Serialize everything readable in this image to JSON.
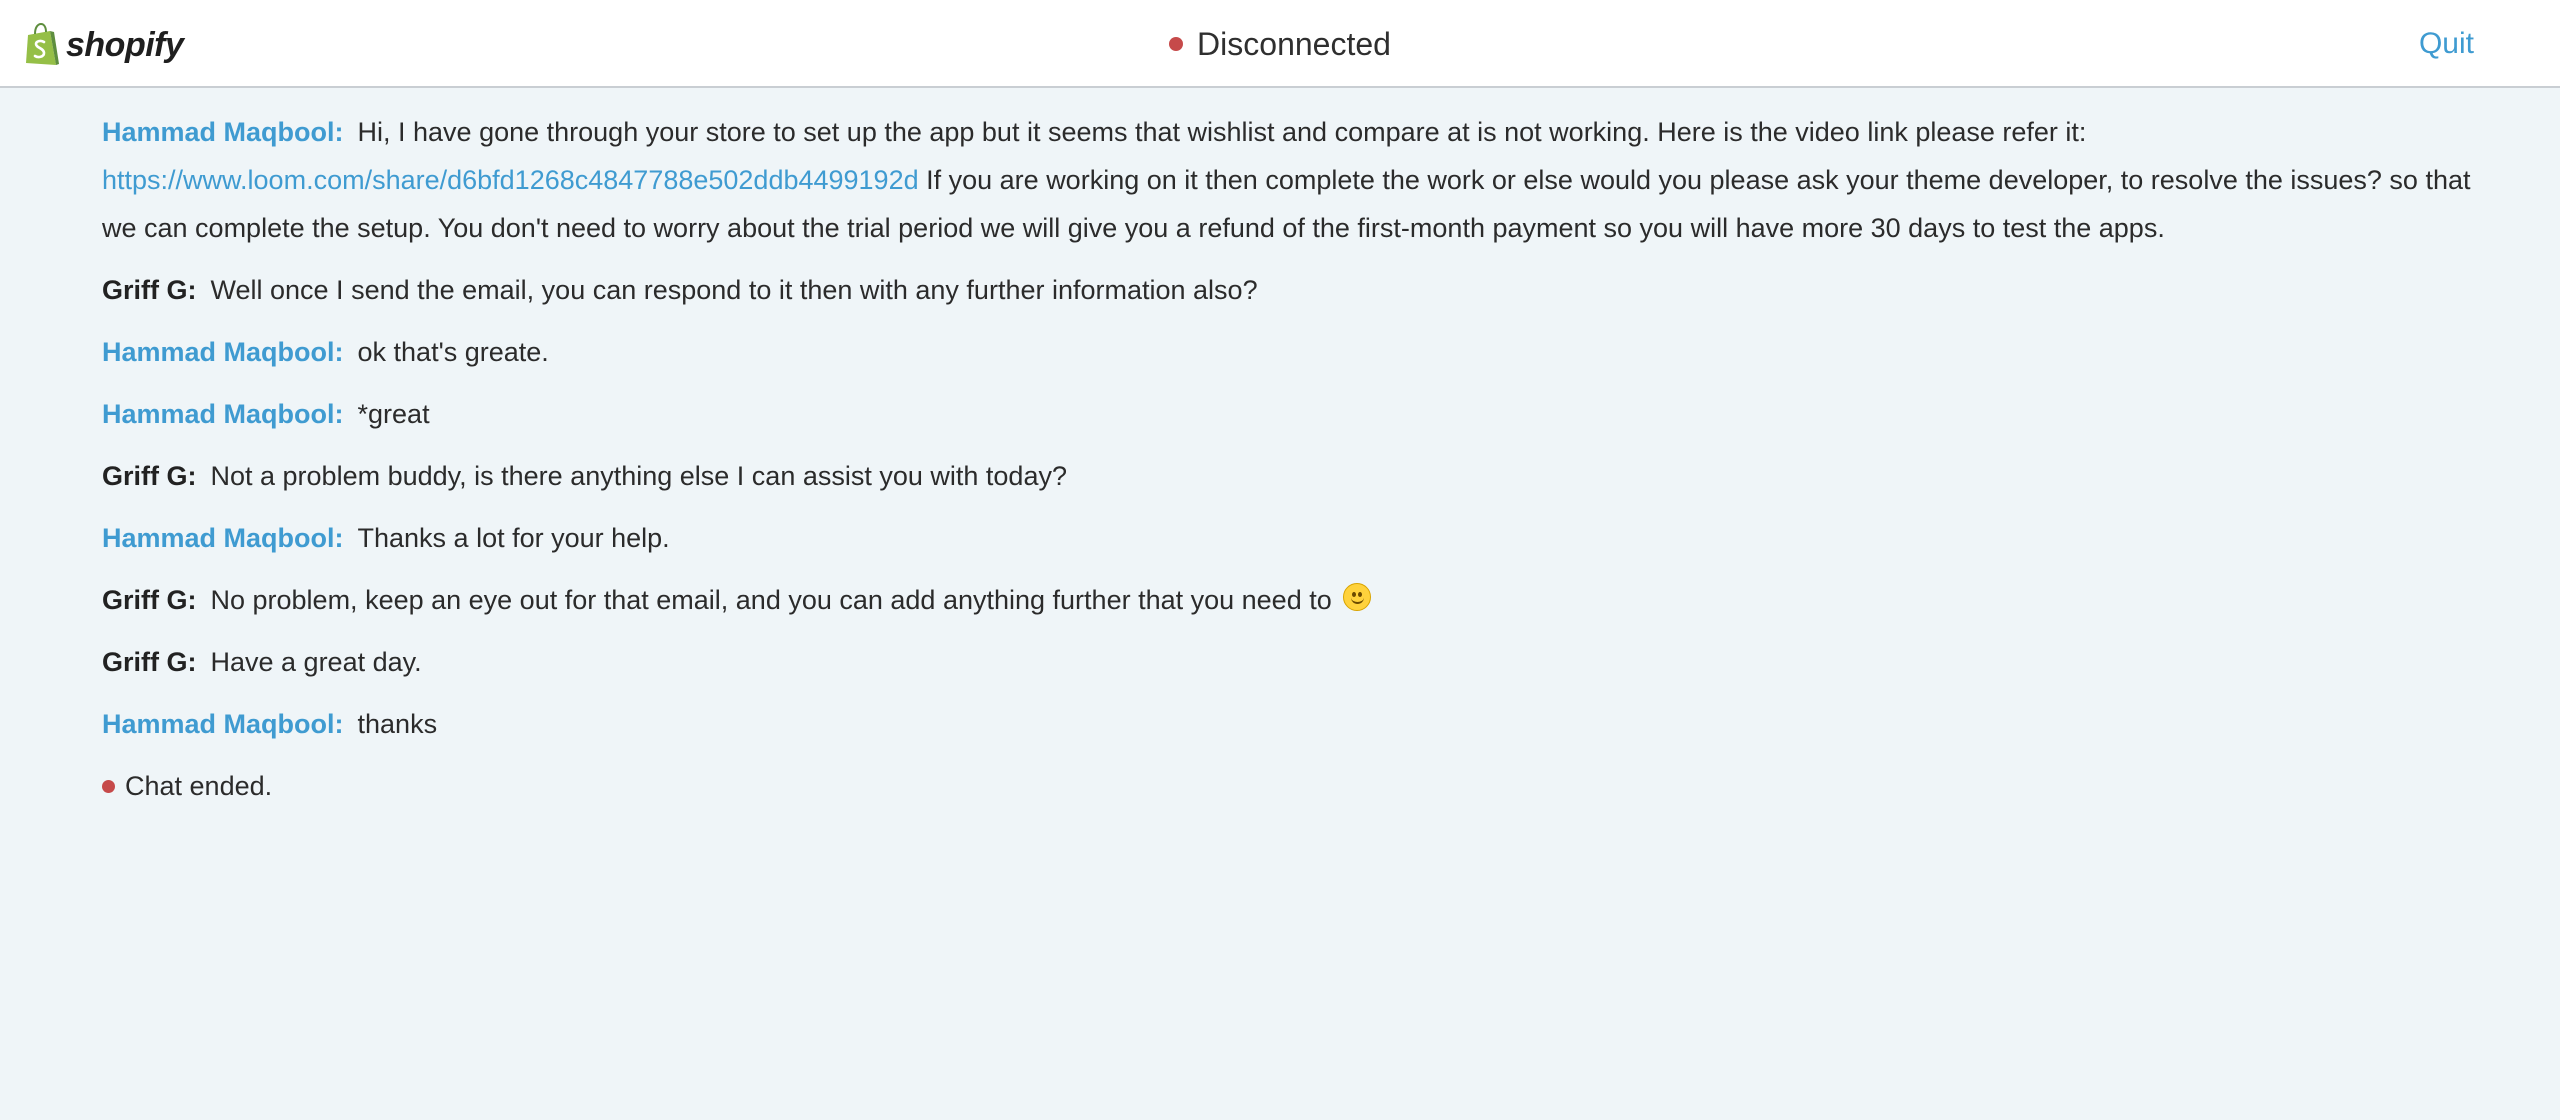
{
  "header": {
    "logo_text": "shopify",
    "status": "Disconnected",
    "status_color": "#c64a4a",
    "quit_label": "Quit"
  },
  "colors": {
    "accent": "#3f9bd1",
    "background": "#eff5f8"
  },
  "messages": [
    {
      "sender": "Hammad Maqbool:",
      "role": "customer",
      "text_before_link": "Hi, I have gone through your store to set up the app but it seems that wishlist and compare at is not working. Here is the video link please refer it:",
      "link": "https://www.loom.com/share/d6bfd1268c4847788e502ddb4499192d",
      "text_after_link": "If you are working on it then complete the work or else would you please ask your theme developer, to resolve the issues? so that we can complete the setup. You don't need to worry about the trial period we will give you a refund of the first-month payment so you will have more 30 days to test the apps."
    },
    {
      "sender": "Griff G:",
      "role": "agent",
      "text": "Well once I send the email, you can respond to it then with any further information also?"
    },
    {
      "sender": "Hammad Maqbool:",
      "role": "customer",
      "text": "ok that's greate."
    },
    {
      "sender": "Hammad Maqbool:",
      "role": "customer",
      "text": "*great"
    },
    {
      "sender": "Griff G:",
      "role": "agent",
      "text": "Not a problem buddy, is there anything else I can assist you with today?"
    },
    {
      "sender": "Hammad Maqbool:",
      "role": "customer",
      "text": "Thanks a lot for your help."
    },
    {
      "sender": "Griff G:",
      "role": "agent",
      "text": "No problem, keep an eye out for that email, and you can add anything further that you need to",
      "icon": "smiley-emoji-icon"
    },
    {
      "sender": "Griff G:",
      "role": "agent",
      "text": "Have a great day."
    },
    {
      "sender": "Hammad Maqbool:",
      "role": "customer",
      "text": "thanks"
    }
  ],
  "chat_ended": "Chat ended."
}
